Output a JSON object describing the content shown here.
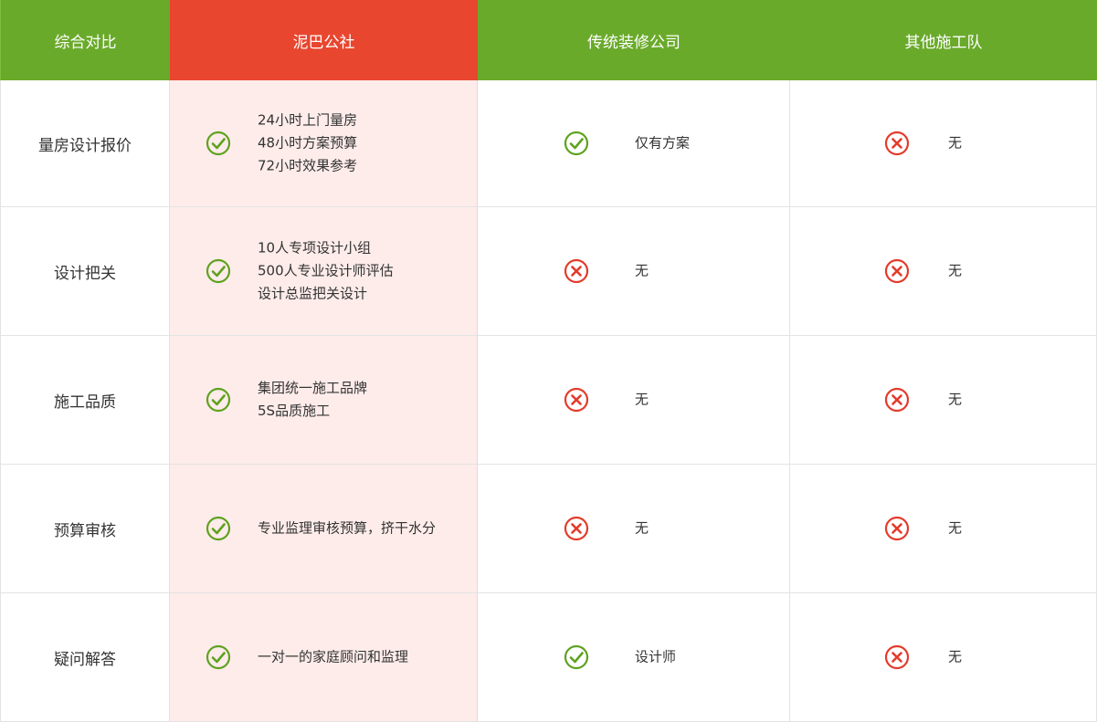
{
  "colors": {
    "header_green": "#6aaa2a",
    "header_brand": "#e8462f",
    "brand_col_bg": "#fdecea",
    "check": "#5fa21f",
    "cross": "#e33b2b"
  },
  "header": {
    "col0": "综合对比",
    "col1": "泥巴公社",
    "col2": "传统装修公司",
    "col3": "其他施工队"
  },
  "rows": [
    {
      "label": "量房设计报价",
      "brand": {
        "icon": "check-icon",
        "lines": [
          "24小时上门量房",
          "48小时方案预算",
          "72小时效果参考"
        ]
      },
      "trad": {
        "icon": "check-icon",
        "lines": [
          "仅有方案"
        ]
      },
      "other": {
        "icon": "cross-icon",
        "lines": [
          "无"
        ]
      }
    },
    {
      "label": "设计把关",
      "brand": {
        "icon": "check-icon",
        "lines": [
          "10人专项设计小组",
          "500人专业设计师评估",
          "设计总监把关设计"
        ]
      },
      "trad": {
        "icon": "cross-icon",
        "lines": [
          "无"
        ]
      },
      "other": {
        "icon": "cross-icon",
        "lines": [
          "无"
        ]
      }
    },
    {
      "label": "施工品质",
      "brand": {
        "icon": "check-icon",
        "lines": [
          "集团统一施工品牌",
          "5S品质施工"
        ]
      },
      "trad": {
        "icon": "cross-icon",
        "lines": [
          "无"
        ]
      },
      "other": {
        "icon": "cross-icon",
        "lines": [
          "无"
        ]
      }
    },
    {
      "label": "预算审核",
      "brand": {
        "icon": "check-icon",
        "lines": [
          "专业监理审核预算，挤干水分"
        ]
      },
      "trad": {
        "icon": "cross-icon",
        "lines": [
          "无"
        ]
      },
      "other": {
        "icon": "cross-icon",
        "lines": [
          "无"
        ]
      }
    },
    {
      "label": "疑问解答",
      "brand": {
        "icon": "check-icon",
        "lines": [
          "一对一的家庭顾问和监理"
        ]
      },
      "trad": {
        "icon": "check-icon",
        "lines": [
          "设计师"
        ]
      },
      "other": {
        "icon": "cross-icon",
        "lines": [
          "无"
        ]
      }
    }
  ]
}
